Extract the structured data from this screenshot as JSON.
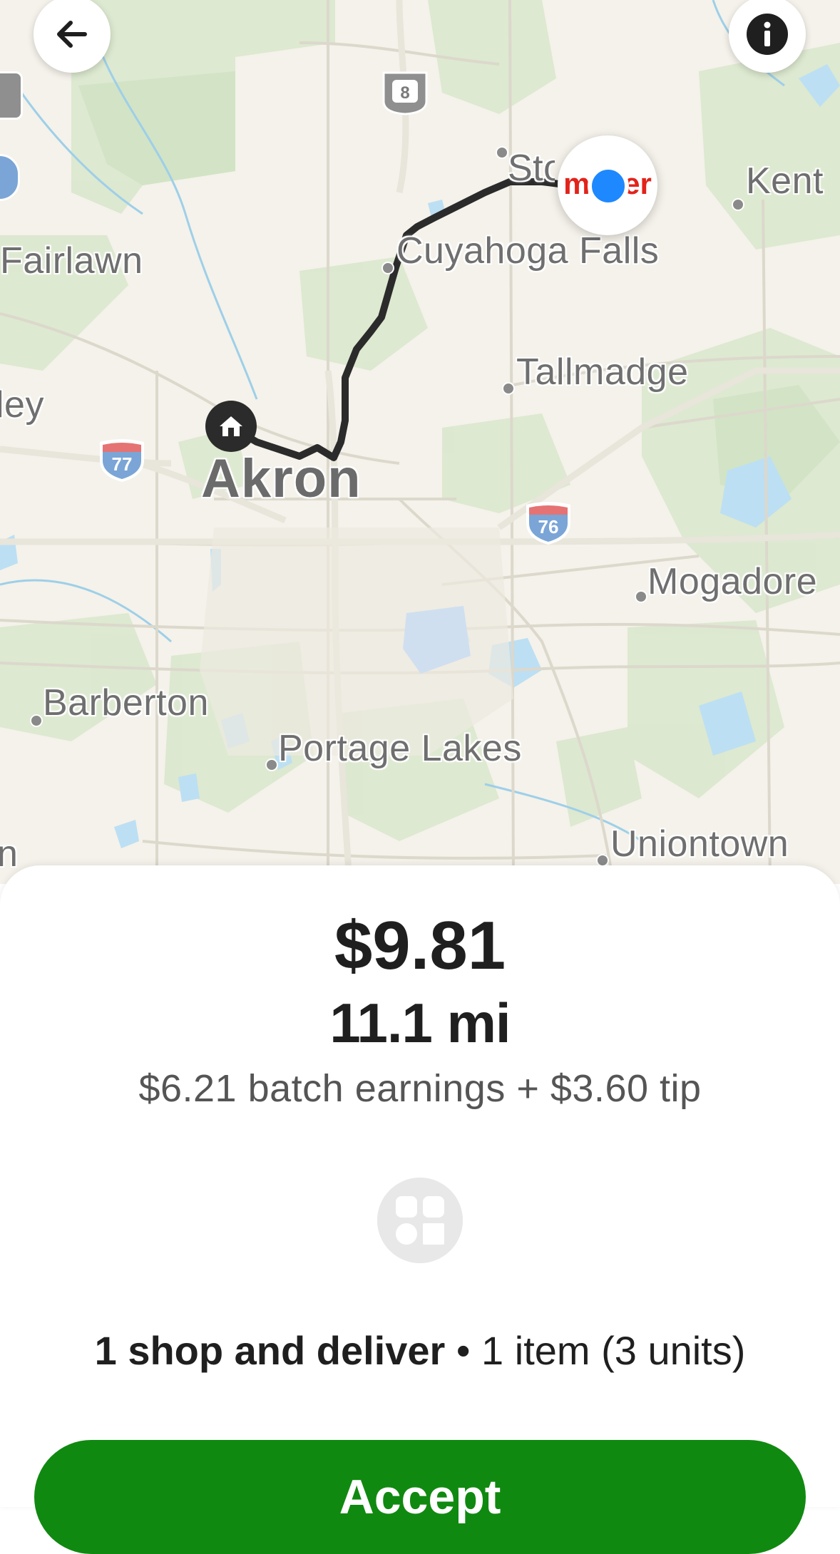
{
  "map": {
    "cities": [
      {
        "name": "Fairlawn"
      },
      {
        "name": "Stow"
      },
      {
        "name": "Kent"
      },
      {
        "name": "Cuyahoga Falls"
      },
      {
        "name": "Tallmadge"
      },
      {
        "name": "Akron"
      },
      {
        "name": "Mogadore"
      },
      {
        "name": "Barberton"
      },
      {
        "name": "Portage Lakes"
      },
      {
        "name": "Uniontown"
      }
    ],
    "partial_labels": {
      "left_edge_ley": "ley",
      "left_edge_n": "n"
    },
    "highway_shields": [
      {
        "number": "8",
        "type": "state"
      },
      {
        "number": "77",
        "type": "interstate"
      },
      {
        "number": "76",
        "type": "interstate"
      }
    ],
    "store_logo_text": "meijer",
    "colors": {
      "route": "#2b2b2b",
      "water": "#b9dcf2",
      "park": "#d7e7cc",
      "road": "#dedbd0",
      "location": "#1e88ff"
    }
  },
  "header": {
    "back_icon": "arrow-left-icon",
    "info_icon": "info-icon"
  },
  "offer": {
    "amount": "$9.81",
    "distance": "11.1 mi",
    "earnings_breakdown": "$6.21 batch earnings + $3.60 tip",
    "category_icon": "grid-icon",
    "summary_strong": "1 shop and deliver",
    "summary_separator": " • ",
    "summary_rest": "1 item (3 units)",
    "accept_label": "Accept"
  },
  "colors": {
    "accept_button": "#108910",
    "text_primary": "#1f1f1f",
    "text_secondary": "#555555"
  }
}
